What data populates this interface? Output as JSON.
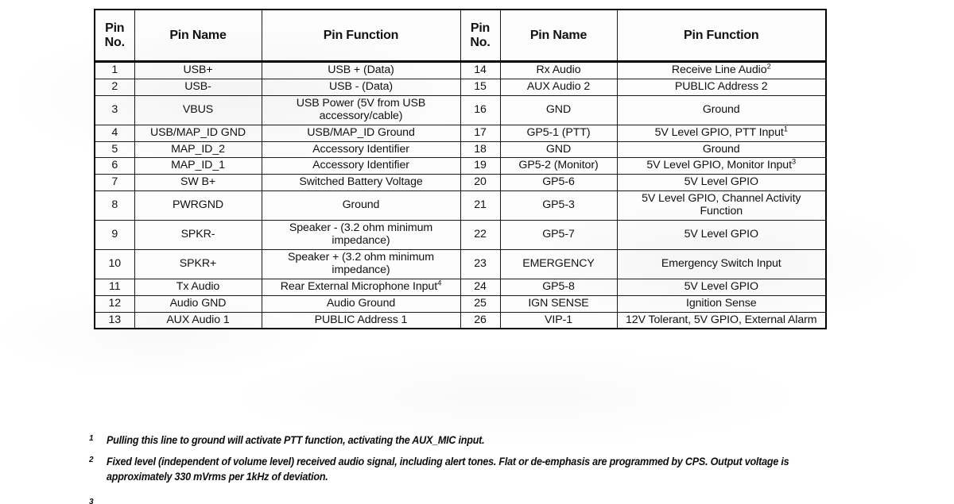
{
  "document": {
    "kind": "scanned-spec-table",
    "table": {
      "headers_left": {
        "pin_no": "Pin\nNo.",
        "pin_no_line1": "Pin",
        "pin_no_line2": "No.",
        "pin_name": "Pin Name",
        "pin_function": "Pin Function"
      },
      "headers_right": {
        "pin_no_line1": "Pin",
        "pin_no_line2": "No.",
        "pin_name": "Pin Name",
        "pin_function": "Pin Function"
      },
      "rows": [
        {
          "left": {
            "no": "1",
            "name": "USB+",
            "func": "USB + (Data)",
            "sup": ""
          },
          "right": {
            "no": "14",
            "name": "Rx Audio",
            "func": "Receive Line Audio",
            "sup": "2"
          }
        },
        {
          "left": {
            "no": "2",
            "name": "USB-",
            "func": "USB - (Data)",
            "sup": ""
          },
          "right": {
            "no": "15",
            "name": "AUX Audio 2",
            "func": "PUBLIC Address 2",
            "sup": ""
          }
        },
        {
          "left": {
            "no": "3",
            "name": "VBUS",
            "func": "USB Power (5V from USB accessory/cable)",
            "sup": ""
          },
          "right": {
            "no": "16",
            "name": "GND",
            "func": "Ground",
            "sup": ""
          }
        },
        {
          "left": {
            "no": "4",
            "name": "USB/MAP_ID GND",
            "func": "USB/MAP_ID Ground",
            "sup": ""
          },
          "right": {
            "no": "17",
            "name": "GP5-1 (PTT)",
            "func": "5V Level GPIO, PTT Input",
            "sup": "1"
          }
        },
        {
          "left": {
            "no": "5",
            "name": "MAP_ID_2",
            "func": "Accessory Identifier",
            "sup": ""
          },
          "right": {
            "no": "18",
            "name": "GND",
            "func": "Ground",
            "sup": ""
          }
        },
        {
          "left": {
            "no": "6",
            "name": "MAP_ID_1",
            "func": "Accessory Identifier",
            "sup": ""
          },
          "right": {
            "no": "19",
            "name": "GP5-2 (Monitor)",
            "func": "5V Level GPIO, Monitor Input",
            "sup": "3"
          }
        },
        {
          "left": {
            "no": "7",
            "name": "SW B+",
            "func": "Switched Battery Voltage",
            "sup": ""
          },
          "right": {
            "no": "20",
            "name": "GP5-6",
            "func": "5V Level GPIO",
            "sup": ""
          }
        },
        {
          "left": {
            "no": "8",
            "name": "PWRGND",
            "func": "Ground",
            "sup": ""
          },
          "right": {
            "no": "21",
            "name": "GP5-3",
            "func": "5V Level GPIO, Channel Activity Function",
            "sup": ""
          }
        },
        {
          "left": {
            "no": "9",
            "name": "SPKR-",
            "func": "Speaker - (3.2 ohm minimum impedance)",
            "sup": ""
          },
          "right": {
            "no": "22",
            "name": "GP5-7",
            "func": "5V Level GPIO",
            "sup": ""
          }
        },
        {
          "left": {
            "no": "10",
            "name": "SPKR+",
            "func": "Speaker + (3.2 ohm minimum impedance)",
            "sup": ""
          },
          "right": {
            "no": "23",
            "name": "EMERGENCY",
            "func": "Emergency Switch Input",
            "sup": ""
          }
        },
        {
          "left": {
            "no": "11",
            "name": "Tx Audio",
            "func": "Rear External Microphone Input",
            "sup": "4"
          },
          "right": {
            "no": "24",
            "name": "GP5-8",
            "func": "5V Level GPIO",
            "sup": ""
          }
        },
        {
          "left": {
            "no": "12",
            "name": "Audio GND",
            "func": "Audio Ground",
            "sup": ""
          },
          "right": {
            "no": "25",
            "name": "IGN SENSE",
            "func": "Ignition Sense",
            "sup": ""
          }
        },
        {
          "left": {
            "no": "13",
            "name": "AUX Audio 1",
            "func": "PUBLIC Address 1",
            "sup": ""
          },
          "right": {
            "no": "26",
            "name": "VIP-1",
            "func": "12V Tolerant, 5V GPIO, External Alarm",
            "sup": ""
          }
        }
      ]
    },
    "footnotes": [
      {
        "mark": "1",
        "text": "Pulling this line to ground will activate PTT function, activating the AUX_MIC input."
      },
      {
        "mark": "2",
        "text": "Fixed level (independent of volume level) received audio signal, including alert tones. Flat or de-emphasis are programmed by CPS. Output voltage is approximately 330 mVrms per 1kHz of deviation."
      },
      {
        "mark": "3",
        "text": ""
      }
    ]
  }
}
